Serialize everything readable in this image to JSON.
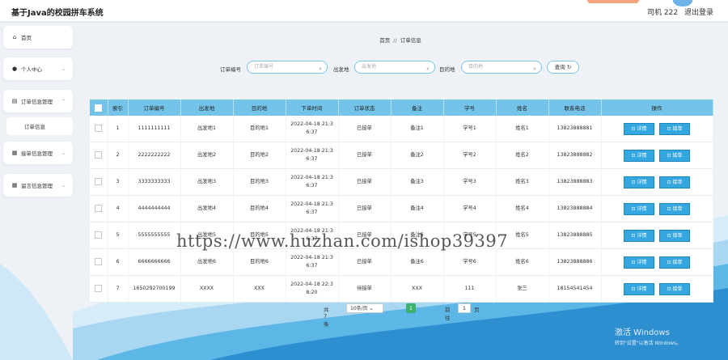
{
  "header": {
    "title": "基于Java的校园拼车系统",
    "user": "司机 222",
    "logout": "退出登录"
  },
  "sidebar": {
    "items": [
      {
        "label": "首页",
        "icon": "home-icon"
      },
      {
        "label": "个人中心",
        "icon": "user-icon"
      },
      {
        "label": "订单信息管理",
        "icon": "list-icon"
      },
      {
        "label": "订单信息",
        "icon": ""
      },
      {
        "label": "接单信息管理",
        "icon": "grid-icon"
      },
      {
        "label": "留言信息管理",
        "icon": "grid-icon"
      }
    ]
  },
  "breadcrumb": {
    "home": "首页",
    "sep": "//",
    "current": "订单信息"
  },
  "search": {
    "order_no_label": "订单编号",
    "order_no_placeholder": "订单编号",
    "origin_label": "出发地",
    "origin_placeholder": "出发地",
    "dest_label": "目的地",
    "dest_placeholder": "目的地",
    "query_label": "查询"
  },
  "table": {
    "columns": [
      "索引",
      "订单编号",
      "出发地",
      "目的地",
      "下单时间",
      "订单状态",
      "备注",
      "学号",
      "姓名",
      "联系电话",
      "操作"
    ],
    "rows": [
      [
        "1",
        "1111111111",
        "出发地1",
        "目的地1",
        "2022-04-18 21:3 6:37",
        "已接单",
        "备注1",
        "学号1",
        "姓名1",
        "13823888881"
      ],
      [
        "2",
        "2222222222",
        "出发地2",
        "目的地2",
        "2022-04-18 21:3 6:37",
        "已接单",
        "备注2",
        "学号2",
        "姓名2",
        "13823888882"
      ],
      [
        "3",
        "3333333333",
        "出发地3",
        "目的地3",
        "2022-04-18 21:3 6:37",
        "已接单",
        "备注3",
        "学号3",
        "姓名3",
        "13823888883"
      ],
      [
        "4",
        "4444444444",
        "出发地4",
        "目的地4",
        "2022-04-18 21:3 6:37",
        "已接单",
        "备注4",
        "学号4",
        "姓名4",
        "13823888884"
      ],
      [
        "5",
        "5555555555",
        "出发地5",
        "目的地5",
        "2022-04-18 21:3 6:37",
        "已接单",
        "备注5",
        "学号5",
        "姓名5",
        "13823888885"
      ],
      [
        "6",
        "6666666666",
        "出发地6",
        "目的地6",
        "2022-04-18 21:3 6:37",
        "已接单",
        "备注6",
        "学号6",
        "姓名6",
        "13823888886"
      ],
      [
        "7",
        "1650292700199",
        "XXXX",
        "XXX",
        "2022-04-18 22:3 8:20",
        "待接单",
        "XXX",
        "111",
        "张三",
        "18154541454"
      ]
    ],
    "detail_label": "详情",
    "accept_label": "接单"
  },
  "pagination": {
    "total": "共 7 条",
    "page_size": "10条/页",
    "prev": "‹",
    "current": "1",
    "next": "›",
    "goto_label": "前往",
    "goto_value": "1",
    "page_unit": "页"
  },
  "watermark": "https://www.huzhan.com/ishop39397",
  "windows": {
    "line1": "激活 Windows",
    "line2": "转到\"设置\"以激活 Windows。"
  },
  "colors": {
    "table_header": "#74c4ea",
    "button": "#35a7e0",
    "page_current": "#3bb36f"
  }
}
